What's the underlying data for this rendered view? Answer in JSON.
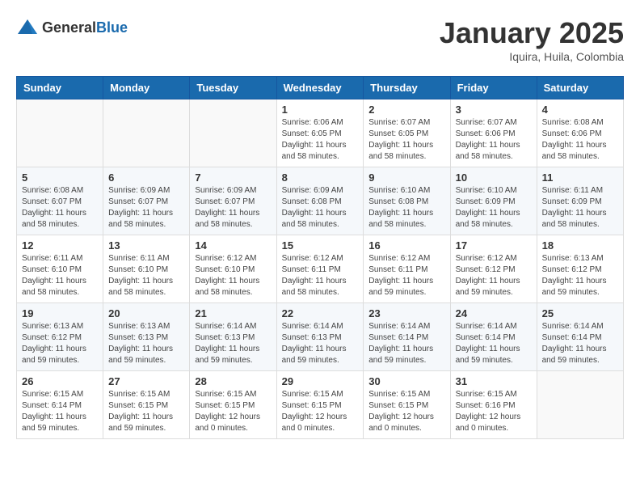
{
  "header": {
    "logo_general": "General",
    "logo_blue": "Blue",
    "title": "January 2025",
    "subtitle": "Iquira, Huila, Colombia"
  },
  "weekdays": [
    "Sunday",
    "Monday",
    "Tuesday",
    "Wednesday",
    "Thursday",
    "Friday",
    "Saturday"
  ],
  "weeks": [
    [
      {
        "day": "",
        "detail": ""
      },
      {
        "day": "",
        "detail": ""
      },
      {
        "day": "",
        "detail": ""
      },
      {
        "day": "1",
        "detail": "Sunrise: 6:06 AM\nSunset: 6:05 PM\nDaylight: 11 hours\nand 58 minutes."
      },
      {
        "day": "2",
        "detail": "Sunrise: 6:07 AM\nSunset: 6:05 PM\nDaylight: 11 hours\nand 58 minutes."
      },
      {
        "day": "3",
        "detail": "Sunrise: 6:07 AM\nSunset: 6:06 PM\nDaylight: 11 hours\nand 58 minutes."
      },
      {
        "day": "4",
        "detail": "Sunrise: 6:08 AM\nSunset: 6:06 PM\nDaylight: 11 hours\nand 58 minutes."
      }
    ],
    [
      {
        "day": "5",
        "detail": "Sunrise: 6:08 AM\nSunset: 6:07 PM\nDaylight: 11 hours\nand 58 minutes."
      },
      {
        "day": "6",
        "detail": "Sunrise: 6:09 AM\nSunset: 6:07 PM\nDaylight: 11 hours\nand 58 minutes."
      },
      {
        "day": "7",
        "detail": "Sunrise: 6:09 AM\nSunset: 6:07 PM\nDaylight: 11 hours\nand 58 minutes."
      },
      {
        "day": "8",
        "detail": "Sunrise: 6:09 AM\nSunset: 6:08 PM\nDaylight: 11 hours\nand 58 minutes."
      },
      {
        "day": "9",
        "detail": "Sunrise: 6:10 AM\nSunset: 6:08 PM\nDaylight: 11 hours\nand 58 minutes."
      },
      {
        "day": "10",
        "detail": "Sunrise: 6:10 AM\nSunset: 6:09 PM\nDaylight: 11 hours\nand 58 minutes."
      },
      {
        "day": "11",
        "detail": "Sunrise: 6:11 AM\nSunset: 6:09 PM\nDaylight: 11 hours\nand 58 minutes."
      }
    ],
    [
      {
        "day": "12",
        "detail": "Sunrise: 6:11 AM\nSunset: 6:10 PM\nDaylight: 11 hours\nand 58 minutes."
      },
      {
        "day": "13",
        "detail": "Sunrise: 6:11 AM\nSunset: 6:10 PM\nDaylight: 11 hours\nand 58 minutes."
      },
      {
        "day": "14",
        "detail": "Sunrise: 6:12 AM\nSunset: 6:10 PM\nDaylight: 11 hours\nand 58 minutes."
      },
      {
        "day": "15",
        "detail": "Sunrise: 6:12 AM\nSunset: 6:11 PM\nDaylight: 11 hours\nand 58 minutes."
      },
      {
        "day": "16",
        "detail": "Sunrise: 6:12 AM\nSunset: 6:11 PM\nDaylight: 11 hours\nand 59 minutes."
      },
      {
        "day": "17",
        "detail": "Sunrise: 6:12 AM\nSunset: 6:12 PM\nDaylight: 11 hours\nand 59 minutes."
      },
      {
        "day": "18",
        "detail": "Sunrise: 6:13 AM\nSunset: 6:12 PM\nDaylight: 11 hours\nand 59 minutes."
      }
    ],
    [
      {
        "day": "19",
        "detail": "Sunrise: 6:13 AM\nSunset: 6:12 PM\nDaylight: 11 hours\nand 59 minutes."
      },
      {
        "day": "20",
        "detail": "Sunrise: 6:13 AM\nSunset: 6:13 PM\nDaylight: 11 hours\nand 59 minutes."
      },
      {
        "day": "21",
        "detail": "Sunrise: 6:14 AM\nSunset: 6:13 PM\nDaylight: 11 hours\nand 59 minutes."
      },
      {
        "day": "22",
        "detail": "Sunrise: 6:14 AM\nSunset: 6:13 PM\nDaylight: 11 hours\nand 59 minutes."
      },
      {
        "day": "23",
        "detail": "Sunrise: 6:14 AM\nSunset: 6:14 PM\nDaylight: 11 hours\nand 59 minutes."
      },
      {
        "day": "24",
        "detail": "Sunrise: 6:14 AM\nSunset: 6:14 PM\nDaylight: 11 hours\nand 59 minutes."
      },
      {
        "day": "25",
        "detail": "Sunrise: 6:14 AM\nSunset: 6:14 PM\nDaylight: 11 hours\nand 59 minutes."
      }
    ],
    [
      {
        "day": "26",
        "detail": "Sunrise: 6:15 AM\nSunset: 6:14 PM\nDaylight: 11 hours\nand 59 minutes."
      },
      {
        "day": "27",
        "detail": "Sunrise: 6:15 AM\nSunset: 6:15 PM\nDaylight: 11 hours\nand 59 minutes."
      },
      {
        "day": "28",
        "detail": "Sunrise: 6:15 AM\nSunset: 6:15 PM\nDaylight: 12 hours\nand 0 minutes."
      },
      {
        "day": "29",
        "detail": "Sunrise: 6:15 AM\nSunset: 6:15 PM\nDaylight: 12 hours\nand 0 minutes."
      },
      {
        "day": "30",
        "detail": "Sunrise: 6:15 AM\nSunset: 6:15 PM\nDaylight: 12 hours\nand 0 minutes."
      },
      {
        "day": "31",
        "detail": "Sunrise: 6:15 AM\nSunset: 6:16 PM\nDaylight: 12 hours\nand 0 minutes."
      },
      {
        "day": "",
        "detail": ""
      }
    ]
  ]
}
